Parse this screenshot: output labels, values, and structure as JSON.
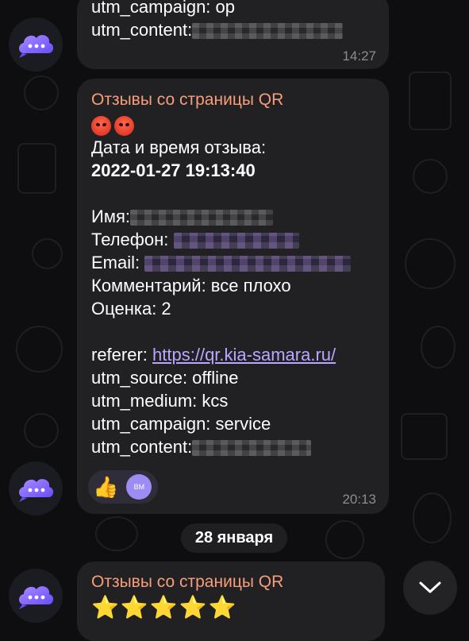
{
  "messages": [
    {
      "lines": [
        {
          "label": "utm_campaign: op"
        },
        {
          "label": "utm_content:"
        }
      ],
      "time": "14:27"
    },
    {
      "sender": "Отзывы со страницы QR",
      "emoji": "😡😡",
      "datetime_label": "Дата и время отзыва:",
      "datetime_value": "2022-01-27 19:13:40",
      "name_label": "Имя:",
      "phone_label": "Телефон:",
      "email_label": "Email:",
      "comment": "Комментарий: все плохо",
      "rating": "Оценка: 2",
      "referer_label": "referer: ",
      "referer_url": "https://qr.kia-samara.ru/",
      "utm_source": "utm_source: offline",
      "utm_medium": "utm_medium: kcs",
      "utm_campaign": "utm_campaign: service",
      "utm_content_label": "utm_content:",
      "reaction_emoji": "👍",
      "reaction_avatar": "BM",
      "time": "20:13"
    },
    {
      "sender": "Отзывы со страницы QR",
      "stars": "⭐⭐⭐⭐⭐"
    }
  ],
  "date_separator": "28 января",
  "icons": {
    "avatar": "chat-bubble-cloud-icon",
    "scroll": "chevron-down-icon"
  },
  "colors": {
    "background": "#0e0e10",
    "bubble": "#212124",
    "sender": "#f79d7a",
    "link": "#bba7ff",
    "avatar_accent": "#7c5cff"
  }
}
